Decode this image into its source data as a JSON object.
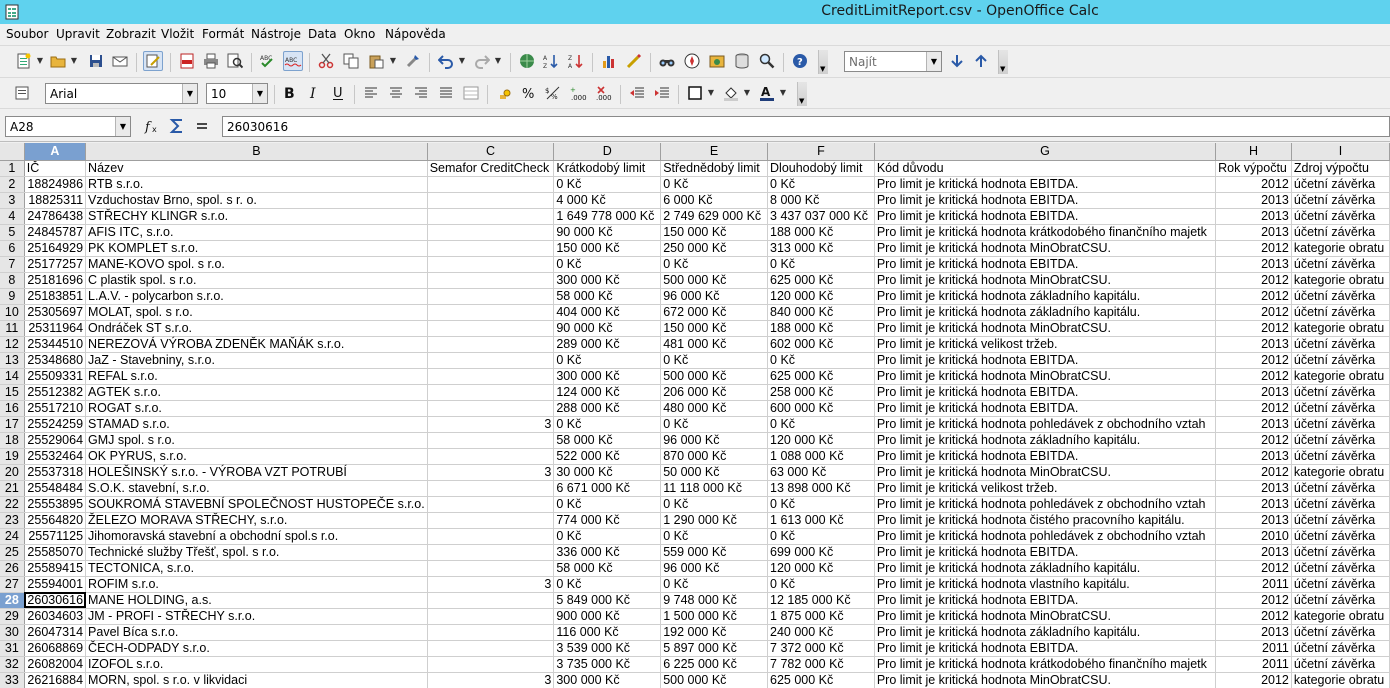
{
  "window": {
    "title": "CreditLimitReport.csv - OpenOffice Calc"
  },
  "menu": [
    "Soubor",
    "Upravit",
    "Zobrazit",
    "Vložit",
    "Formát",
    "Nástroje",
    "Data",
    "Okno",
    "Nápověda"
  ],
  "toolbar": {
    "find_placeholder": "Najít"
  },
  "format_toolbar": {
    "font_name": "Arial",
    "font_size": "10"
  },
  "formula_bar": {
    "name_box": "A28",
    "value": "26030616"
  },
  "sheet": {
    "columns": [
      "A",
      "B",
      "C",
      "D",
      "E",
      "F",
      "G",
      "H",
      "I"
    ],
    "selected_column": "A",
    "selected_row": 28,
    "header": [
      "IČ",
      "Název",
      "Semafor CreditCheck",
      "Krátkodobý limit",
      "Střednědobý limit",
      "Dlouhodobý limit",
      "Kód důvodu",
      "Rok výpočtu",
      "Zdroj výpočtu"
    ],
    "rows": [
      [
        "18824986",
        "RTB s.r.o.",
        "",
        "0 Kč",
        "0 Kč",
        "0 Kč",
        "Pro limit je kritická hodnota EBITDA.",
        "2012",
        "účetní závěrka"
      ],
      [
        "18825311",
        "Vzduchostav Brno, spol. s r. o.",
        "",
        "4 000 Kč",
        "6 000 Kč",
        "8 000 Kč",
        "Pro limit je kritická hodnota EBITDA.",
        "2013",
        "účetní závěrka"
      ],
      [
        "24786438",
        "STŘECHY KLINGR s.r.o.",
        "",
        "1 649 778 000 Kč",
        "2 749 629 000 Kč",
        "3 437 037 000 Kč",
        "Pro limit je kritická hodnota EBITDA.",
        "2013",
        "účetní závěrka"
      ],
      [
        "24845787",
        "AFIS ITC, s.r.o.",
        "",
        "90 000 Kč",
        "150 000 Kč",
        "188 000 Kč",
        "Pro limit je kritická hodnota krátkodobého finančního majetk",
        "2013",
        "účetní závěrka"
      ],
      [
        "25164929",
        "PK KOMPLET s.r.o.",
        "",
        "150 000 Kč",
        "250 000 Kč",
        "313 000 Kč",
        "Pro limit je kritická hodnota MinObratCSU.",
        "2012",
        "kategorie obratu"
      ],
      [
        "25177257",
        "MANE-KOVO spol. s r.o.",
        "",
        "0 Kč",
        "0 Kč",
        "0 Kč",
        "Pro limit je kritická hodnota EBITDA.",
        "2013",
        "účetní závěrka"
      ],
      [
        "25181696",
        "C plastik spol. s r.o.",
        "",
        "300 000 Kč",
        "500 000 Kč",
        "625 000 Kč",
        "Pro limit je kritická hodnota MinObratCSU.",
        "2012",
        "kategorie obratu"
      ],
      [
        "25183851",
        "L.A.V. - polycarbon s.r.o.",
        "",
        "58 000 Kč",
        "96 000 Kč",
        "120 000 Kč",
        "Pro limit je kritická hodnota základního kapitálu.",
        "2012",
        "účetní závěrka"
      ],
      [
        "25305697",
        "MOLAT, spol. s r.o.",
        "",
        "404 000 Kč",
        "672 000 Kč",
        "840 000 Kč",
        "Pro limit je kritická hodnota základního kapitálu.",
        "2012",
        "účetní závěrka"
      ],
      [
        "25311964",
        "Ondráček ST s.r.o.",
        "",
        "90 000 Kč",
        "150 000 Kč",
        "188 000 Kč",
        "Pro limit je kritická hodnota MinObratCSU.",
        "2012",
        "kategorie obratu"
      ],
      [
        "25344510",
        "NEREZOVÁ VÝROBA ZDENĚK MAŇÁK s.r.o.",
        "",
        "289 000 Kč",
        "481 000 Kč",
        "602 000 Kč",
        "Pro limit je kritická velikost tržeb.",
        "2013",
        "účetní závěrka"
      ],
      [
        "25348680",
        "JaZ - Stavebniny, s.r.o.",
        "",
        "0 Kč",
        "0 Kč",
        "0 Kč",
        "Pro limit je kritická hodnota EBITDA.",
        "2012",
        "účetní závěrka"
      ],
      [
        "25509331",
        "REFAL s.r.o.",
        "",
        "300 000 Kč",
        "500 000 Kč",
        "625 000 Kč",
        "Pro limit je kritická hodnota MinObratCSU.",
        "2012",
        "kategorie obratu"
      ],
      [
        "25512382",
        "AGTEK s.r.o.",
        "",
        "124 000 Kč",
        "206 000 Kč",
        "258 000 Kč",
        "Pro limit je kritická hodnota EBITDA.",
        "2013",
        "účetní závěrka"
      ],
      [
        "25517210",
        "ROGAT s.r.o.",
        "",
        "288 000 Kč",
        "480 000 Kč",
        "600 000 Kč",
        "Pro limit je kritická hodnota EBITDA.",
        "2012",
        "účetní závěrka"
      ],
      [
        "25524259",
        "STAMAD s.r.o.",
        "3",
        "0 Kč",
        "0 Kč",
        "0 Kč",
        "Pro limit je kritická hodnota pohledávek z obchodního vztah",
        "2013",
        "účetní závěrka"
      ],
      [
        "25529064",
        "GMJ spol. s r.o.",
        "",
        "58 000 Kč",
        "96 000 Kč",
        "120 000 Kč",
        "Pro limit je kritická hodnota základního kapitálu.",
        "2012",
        "účetní závěrka"
      ],
      [
        "25532464",
        "OK PYRUS, s.r.o.",
        "",
        "522 000 Kč",
        "870 000 Kč",
        "1 088 000 Kč",
        "Pro limit je kritická hodnota EBITDA.",
        "2013",
        "účetní závěrka"
      ],
      [
        "25537318",
        "HOLEŠINSKÝ s.r.o. - VÝROBA VZT POTRUBÍ",
        "3",
        "30 000 Kč",
        "50 000 Kč",
        "63 000 Kč",
        "Pro limit je kritická hodnota MinObratCSU.",
        "2012",
        "kategorie obratu"
      ],
      [
        "25548484",
        "S.O.K. stavební, s.r.o.",
        "",
        "6 671 000 Kč",
        "11 118 000 Kč",
        "13 898 000 Kč",
        "Pro limit je kritická velikost tržeb.",
        "2013",
        "účetní závěrka"
      ],
      [
        "25553895",
        "SOUKROMÁ STAVEBNÍ SPOLEČNOST HUSTOPEČE s.r.o.",
        "",
        "0 Kč",
        "0 Kč",
        "0 Kč",
        "Pro limit je kritická hodnota pohledávek z obchodního vztah",
        "2013",
        "účetní závěrka"
      ],
      [
        "25564820",
        "ŽELEZO MORAVA STŘECHY, s.r.o.",
        "",
        "774 000 Kč",
        "1 290 000 Kč",
        "1 613 000 Kč",
        "Pro limit je kritická hodnota čistého pracovního kapitálu.",
        "2013",
        "účetní závěrka"
      ],
      [
        "25571125",
        "Jihomoravská stavební a obchodní  spol.s r.o.",
        "",
        "0 Kč",
        "0 Kč",
        "0 Kč",
        "Pro limit je kritická hodnota pohledávek z obchodního vztah",
        "2010",
        "účetní závěrka"
      ],
      [
        "25585070",
        "Technické služby Třešť, spol. s r.o.",
        "",
        "336 000 Kč",
        "559 000 Kč",
        "699 000 Kč",
        "Pro limit je kritická hodnota EBITDA.",
        "2013",
        "účetní závěrka"
      ],
      [
        "25589415",
        "TECTONICA, s.r.o.",
        "",
        "58 000 Kč",
        "96 000 Kč",
        "120 000 Kč",
        "Pro limit je kritická hodnota základního kapitálu.",
        "2012",
        "účetní závěrka"
      ],
      [
        "25594001",
        "ROFIM s.r.o.",
        "3",
        "0 Kč",
        "0 Kč",
        "0 Kč",
        "Pro limit je kritická hodnota vlastního kapitálu.",
        "2011",
        "účetní závěrka"
      ],
      [
        "26030616",
        "MANE HOLDING, a.s.",
        "",
        "5 849 000 Kč",
        "9 748 000 Kč",
        "12 185 000 Kč",
        "Pro limit je kritická hodnota EBITDA.",
        "2012",
        "účetní závěrka"
      ],
      [
        "26034603",
        "JM - PROFI - STŘECHY s.r.o.",
        "",
        "900 000 Kč",
        "1 500 000 Kč",
        "1 875 000 Kč",
        "Pro limit je kritická hodnota MinObratCSU.",
        "2012",
        "kategorie obratu"
      ],
      [
        "26047314",
        "Pavel Bíca s.r.o.",
        "",
        "116 000 Kč",
        "192 000 Kč",
        "240 000 Kč",
        "Pro limit je kritická hodnota základního kapitálu.",
        "2013",
        "účetní závěrka"
      ],
      [
        "26068869",
        "ČECH-ODPADY s.r.o.",
        "",
        "3 539 000 Kč",
        "5 897 000 Kč",
        "7 372 000 Kč",
        "Pro limit je kritická hodnota EBITDA.",
        "2011",
        "účetní závěrka"
      ],
      [
        "26082004",
        "IZOFOL s.r.o.",
        "",
        "3 735 000 Kč",
        "6 225 000 Kč",
        "7 782 000 Kč",
        "Pro limit je kritická hodnota krátkodobého finančního majetk",
        "2011",
        "účetní závěrka"
      ],
      [
        "26216884",
        "MORN, spol. s r.o. v likvidaci",
        "3",
        "300 000 Kč",
        "500 000 Kč",
        "625 000 Kč",
        "Pro limit je kritická hodnota MinObratCSU.",
        "2012",
        "kategorie obratu"
      ]
    ]
  }
}
